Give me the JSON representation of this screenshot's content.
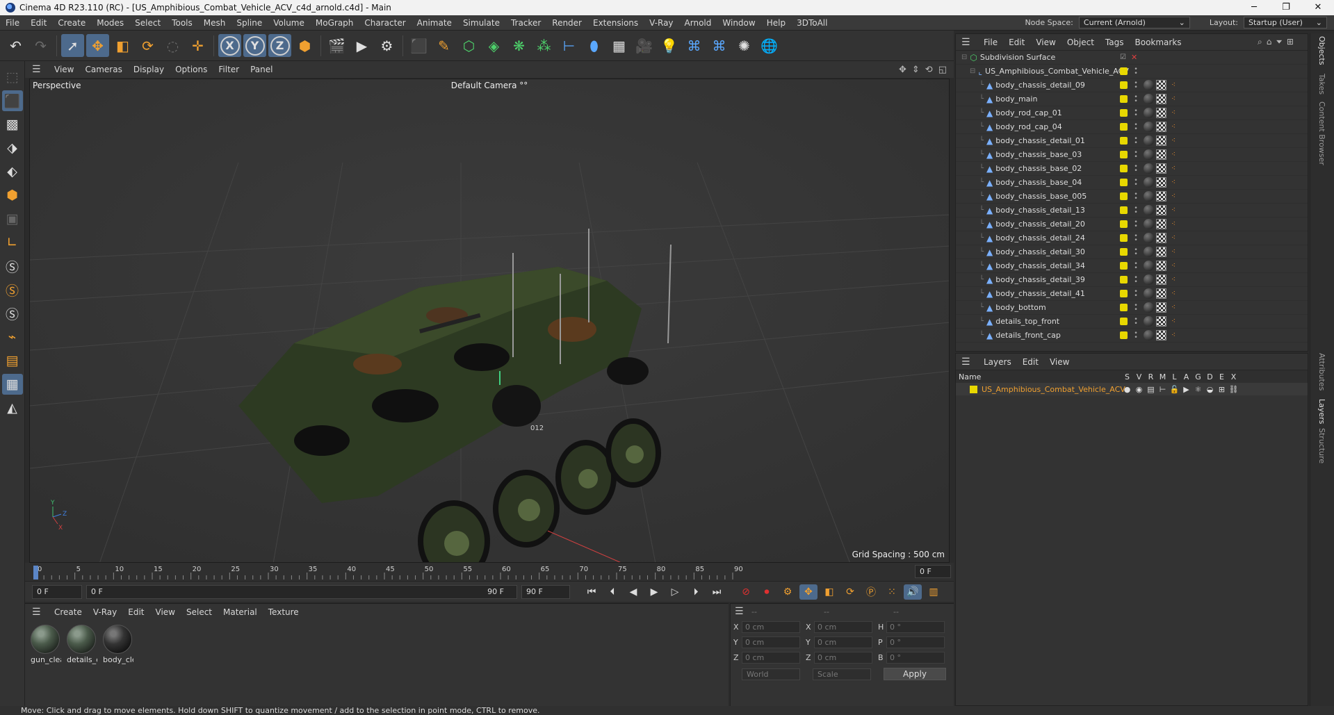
{
  "window": {
    "title": "Cinema 4D R23.110 (RC) - [US_Amphibious_Combat_Vehicle_ACV_c4d_arnold.c4d] - Main",
    "minimize": "─",
    "maximize": "❐",
    "close": "✕"
  },
  "menubar": {
    "items": [
      "File",
      "Edit",
      "Create",
      "Modes",
      "Select",
      "Tools",
      "Mesh",
      "Spline",
      "Volume",
      "MoGraph",
      "Character",
      "Animate",
      "Simulate",
      "Tracker",
      "Render",
      "Extensions",
      "V-Ray",
      "Arnold",
      "Window",
      "Help",
      "3DToAll"
    ],
    "node_space_label": "Node Space:",
    "node_space_value": "Current (Arnold)",
    "layout_label": "Layout:",
    "layout_value": "Startup (User)"
  },
  "viewport_menu": {
    "items": [
      "View",
      "Cameras",
      "Display",
      "Options",
      "Filter",
      "Panel"
    ]
  },
  "viewport": {
    "label": "Perspective",
    "camera": "Default Camera",
    "camera_suffix": "°°",
    "grid_spacing": "Grid Spacing : 500 cm",
    "hull_number": "012",
    "axis_y": "Y",
    "axis_z": "Z",
    "axis_x": "X"
  },
  "timeline": {
    "ticks": [
      "0",
      "5",
      "10",
      "15",
      "20",
      "25",
      "30",
      "35",
      "40",
      "45",
      "50",
      "55",
      "60",
      "65",
      "70",
      "75",
      "80",
      "85",
      "90"
    ],
    "current_frame": "0 F"
  },
  "transport": {
    "start_field": "0 F",
    "range_start": "0 F",
    "range_end": "90 F",
    "end_field": "90 F"
  },
  "materials_menu": {
    "items": [
      "Create",
      "V-Ray",
      "Edit",
      "View",
      "Select",
      "Material",
      "Texture"
    ]
  },
  "materials": [
    {
      "name": "gun_clea"
    },
    {
      "name": "details_c"
    },
    {
      "name": "body_cle"
    }
  ],
  "coordinates": {
    "head": [
      "--",
      "--",
      "--"
    ],
    "rows": [
      {
        "l1": "X",
        "v1": "0 cm",
        "l2": "X",
        "v2": "0 cm",
        "l3": "H",
        "v3": "0 °"
      },
      {
        "l1": "Y",
        "v1": "0 cm",
        "l2": "Y",
        "v2": "0 cm",
        "l3": "P",
        "v3": "0 °"
      },
      {
        "l1": "Z",
        "v1": "0 cm",
        "l2": "Z",
        "v2": "0 cm",
        "l3": "B",
        "v3": "0 °"
      }
    ],
    "world": "World",
    "scale": "Scale",
    "apply": "Apply"
  },
  "objects_menu": {
    "items": [
      "File",
      "Edit",
      "View",
      "Object",
      "Tags",
      "Bookmarks"
    ]
  },
  "objects": {
    "root": "Subdivision Surface",
    "group": "US_Amphibious_Combat_Vehicle_ACV",
    "children": [
      "body_chassis_detail_09",
      "body_main",
      "body_rod_cap_01",
      "body_rod_cap_04",
      "body_chassis_detail_01",
      "body_chassis_base_03",
      "body_chassis_base_02",
      "body_chassis_base_04",
      "body_chassis_base_005",
      "body_chassis_detail_13",
      "body_chassis_detail_20",
      "body_chassis_detail_24",
      "body_chassis_detail_30",
      "body_chassis_detail_34",
      "body_chassis_detail_39",
      "body_chassis_detail_41",
      "body_bottom",
      "details_top_front",
      "details_front_cap"
    ]
  },
  "layers_menu": {
    "items": [
      "Layers",
      "Edit",
      "View"
    ]
  },
  "layers": {
    "name_header": "Name",
    "columns": [
      "S",
      "V",
      "R",
      "M",
      "L",
      "A",
      "G",
      "D",
      "E",
      "X"
    ],
    "rows": [
      {
        "name": "US_Amphibious_Combat_Vehicle_ACV"
      }
    ]
  },
  "side_tabs": [
    "Objects",
    "Takes",
    "Content Browser",
    "Attributes",
    "Layers",
    "Structure"
  ],
  "status": "Move: Click and drag to move elements. Hold down SHIFT to quantize movement / add to the selection in point mode, CTRL to remove."
}
